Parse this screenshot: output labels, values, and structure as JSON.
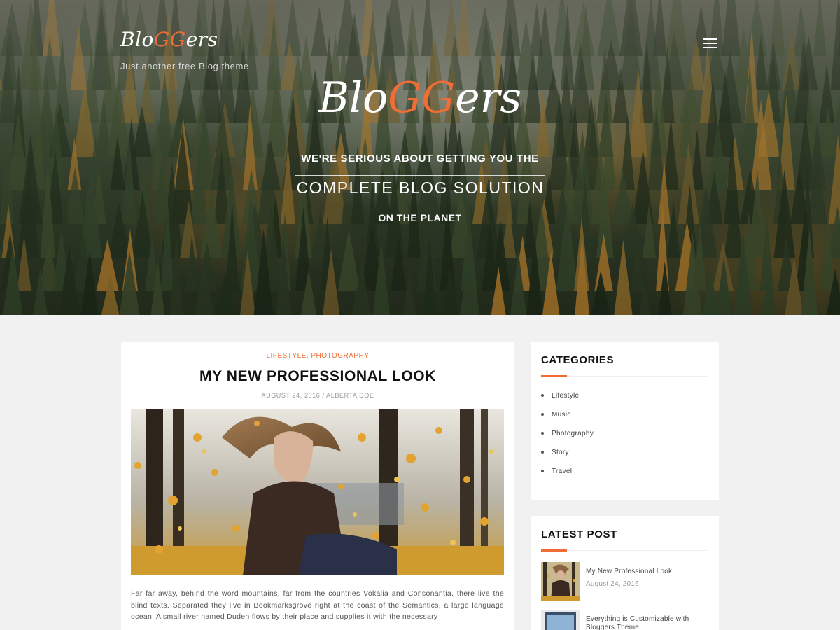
{
  "header": {
    "logo_prefix": "Blo",
    "logo_accent": "GG",
    "logo_suffix": "ers",
    "tagline": "Just another free Blog theme",
    "menu_icon": "hamburger-menu-icon"
  },
  "hero": {
    "logo_prefix": "Blo",
    "logo_accent": "GG",
    "logo_suffix": "ers",
    "line1": "WE'RE SERIOUS ABOUT GETTING YOU THE",
    "line2": "COMPLETE BLOG SOLUTION",
    "line3": "ON THE PLANET"
  },
  "post": {
    "categories": [
      "LIFESTYLE",
      "PHOTOGRAPHY"
    ],
    "category_separator": ",",
    "title": "MY NEW PROFESSIONAL LOOK",
    "meta": "AUGUST 24, 2016 / ALBERTA DOE",
    "excerpt": "Far far away, behind the word mountains, far from the countries Vokalia and Consonantia, there live the blind texts. Separated they live in Bookmarksgrove right at the coast of the Semantics, a large language ocean. A small river named Duden flows by their place and supplies it with the necessary"
  },
  "sidebar": {
    "categories": {
      "title": "CATEGORIES",
      "items": [
        "Lifestyle",
        "Music",
        "Photography",
        "Story",
        "Travel"
      ]
    },
    "latest": {
      "title": "LATEST POST",
      "items": [
        {
          "title": "My New Professional Look",
          "date": "August 24, 2016"
        },
        {
          "title": "Everything is Customizable with Bloggers Theme",
          "date": ""
        }
      ]
    }
  },
  "colors": {
    "accent": "#f26d35",
    "page_background": "#f1f1f1",
    "card_background": "#ffffff"
  }
}
